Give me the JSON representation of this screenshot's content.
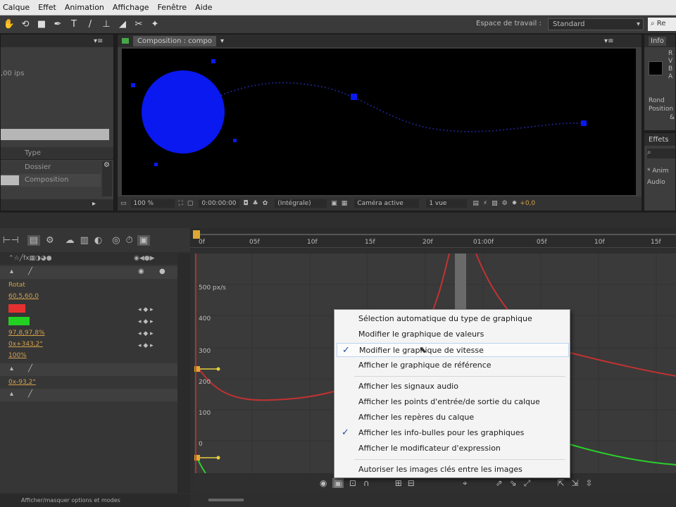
{
  "menubar": {
    "items": [
      "Calque",
      "Effet",
      "Animation",
      "Affichage",
      "Fenêtre",
      "Aide"
    ]
  },
  "toolbar": {
    "workspace_label": "Espace de travail :",
    "workspace_value": "Standard",
    "search_placeholder": "Re"
  },
  "project_panel": {
    "fps_text": ",00 ips",
    "col_type": "Type",
    "items": [
      "Dossier",
      "Composition"
    ]
  },
  "composition_panel": {
    "tab_label": "Composition : compo",
    "zoom": "100 %",
    "timecode": "0:00:00:00",
    "resolution": "(Intégrale)",
    "camera": "Caméra active",
    "views": "1 vue",
    "exposure": "+0,0"
  },
  "info_panel": {
    "title": "Info",
    "rows": [
      "R",
      "V",
      "B",
      "A"
    ],
    "lines": [
      "Rond",
      "Position",
      "&"
    ]
  },
  "effects_panel": {
    "title": "Effets",
    "items": [
      "* Anim",
      "Audio"
    ]
  },
  "timeline": {
    "ruler_labels": [
      "0f",
      "05f",
      "10f",
      "15f",
      "20f",
      "01:00f",
      "05f",
      "10f",
      "15f"
    ],
    "layer_values": [
      "Rotat",
      "60,5,60,0",
      "97,8,97,8%",
      "0x+343,2°",
      "100%",
      "0x-93,2°"
    ],
    "status_text": "Afficher/masquer options et modes",
    "graph_axis": [
      "500 px/s",
      "400",
      "300",
      "200",
      "100",
      "0"
    ]
  },
  "context_menu": {
    "items": [
      {
        "label": "Sélection automatique du type de graphique",
        "checked": false
      },
      {
        "label": "Modifier le graphique de valeurs",
        "checked": false
      },
      {
        "label": "Modifier le graphique de vitesse",
        "checked": true
      },
      {
        "label": "Afficher le graphique de référence",
        "checked": false
      },
      {
        "label": "Afficher les signaux audio",
        "checked": false
      },
      {
        "label": "Afficher les points d'entrée/de sortie du calque",
        "checked": false
      },
      {
        "label": "Afficher les repères du calque",
        "checked": false
      },
      {
        "label": "Afficher les info-bulles pour les graphiques",
        "checked": true
      },
      {
        "label": "Afficher le modificateur d'expression",
        "checked": false
      },
      {
        "label": "Autoriser les images clés entre les images",
        "checked": false
      }
    ],
    "check_glyph": "✓"
  }
}
